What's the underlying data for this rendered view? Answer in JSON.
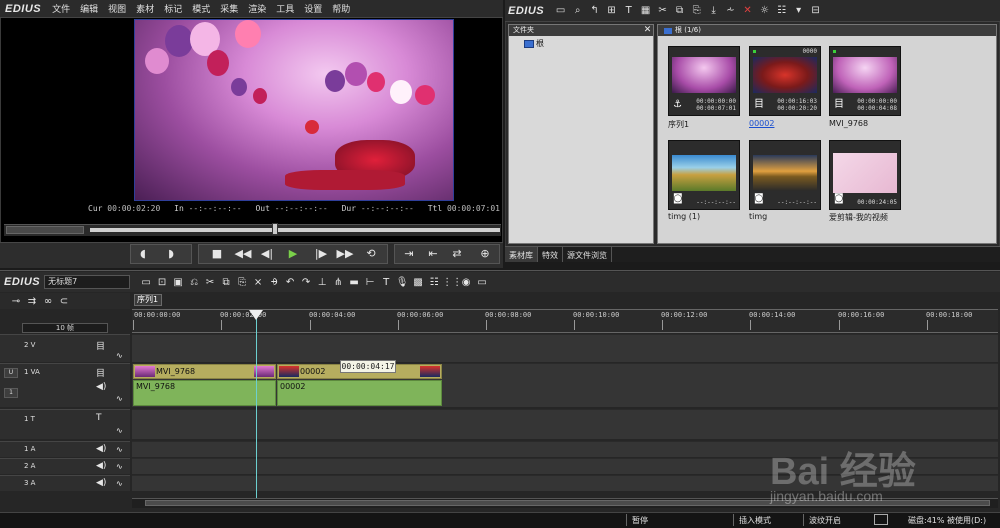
{
  "app": {
    "logo": "EDIUS"
  },
  "menu": [
    "文件",
    "编辑",
    "视图",
    "素材",
    "标记",
    "模式",
    "采集",
    "渲染",
    "工具",
    "设置",
    "帮助"
  ],
  "player": {
    "timecodes": [
      {
        "label": "Cur",
        "value": "00:00:02:20"
      },
      {
        "label": "In",
        "value": "--:--:--:--"
      },
      {
        "label": "Out",
        "value": "--:--:--:--"
      },
      {
        "label": "Dur",
        "value": "--:--:--:--"
      },
      {
        "label": "Ttl",
        "value": "00:00:07:01"
      }
    ]
  },
  "bin": {
    "logo": "EDIUS",
    "folder_header": "文件夹",
    "root_label": "根",
    "clip_header": "根 (1/6)",
    "clips": [
      {
        "name": "序列1",
        "type_icon": "sequence-icon",
        "tc": [
          "00:00:00:00",
          "00:00:07:01"
        ],
        "num": "",
        "selected": false
      },
      {
        "name": "00002",
        "type_icon": "video-icon",
        "tc": [
          "00:00:16:03",
          "00:00:20:20"
        ],
        "num": "0000",
        "selected": true
      },
      {
        "name": "MVI_9768",
        "type_icon": "video-icon",
        "tc": [
          "00:00:00:00",
          "00:00:04:08"
        ],
        "num": "",
        "selected": false
      },
      {
        "name": "timg (1)",
        "type_icon": "camera-icon",
        "tc": [
          "--:--:--:--"
        ],
        "num": "",
        "selected": false
      },
      {
        "name": "timg",
        "type_icon": "camera-icon",
        "tc": [
          "--:--:--:--"
        ],
        "num": "",
        "selected": false
      },
      {
        "name": "爱剪辑-我的视频",
        "type_icon": "camera-icon",
        "tc": [
          "00:00:24:05"
        ],
        "num": "",
        "selected": false
      }
    ],
    "tabs": [
      "素材库",
      "特效",
      "源文件浏览"
    ]
  },
  "timeline": {
    "logo": "EDIUS",
    "project_name": "无标题7",
    "sequence_tab": "序列1",
    "zoom_label": "10 帧",
    "ruler_labels": [
      "00:00:00:00",
      "00:00:02:00",
      "00:00:04:00",
      "00:00:06:00",
      "00:00:08:00",
      "00:00:10:00",
      "00:00:12:00",
      "00:00:14:00",
      "00:00:16:00",
      "00:00:18:00"
    ],
    "tracks": [
      {
        "name": "2 V"
      },
      {
        "name": "1 VA"
      },
      {
        "name": "1 T"
      },
      {
        "name": "1 A"
      },
      {
        "name": "2 A"
      },
      {
        "name": "3 A"
      }
    ],
    "video_clips": [
      {
        "name": "MVI_9768"
      },
      {
        "name": "00002"
      }
    ],
    "audio_clips": [
      {
        "name": "MVI_9768"
      },
      {
        "name": "00002"
      }
    ],
    "tooltip": "00:00:04:17"
  },
  "status": {
    "pause": "暂停",
    "insert_mode": "插入模式",
    "ripple": "波纹开启",
    "disk": "磁盘:41% 被使用(D:)"
  },
  "watermark": {
    "text": "Bai 经验",
    "url": "jingyan.baidu.com"
  }
}
